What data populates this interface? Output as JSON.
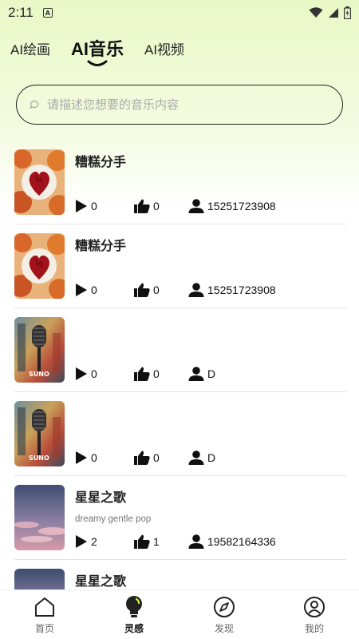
{
  "status_bar": {
    "time": "2:11",
    "notification_icon": "A"
  },
  "tabs": [
    {
      "label": "AI绘画"
    },
    {
      "label": "AI音乐",
      "active": true
    },
    {
      "label": "AI视频"
    }
  ],
  "search": {
    "placeholder": "请描述您想要的音乐内容",
    "value": ""
  },
  "songs": [
    {
      "title": "糟糕分手",
      "subtitle": "",
      "plays": "0",
      "likes": "0",
      "user": "15251723908",
      "cover": "heart-cover"
    },
    {
      "title": "糟糕分手",
      "subtitle": "",
      "plays": "0",
      "likes": "0",
      "user": "15251723908",
      "cover": "heart-cover"
    },
    {
      "title": "",
      "subtitle": "",
      "plays": "0",
      "likes": "0",
      "user": "D",
      "cover": "microphone-cover"
    },
    {
      "title": "",
      "subtitle": "",
      "plays": "0",
      "likes": "0",
      "user": "D",
      "cover": "microphone-cover"
    },
    {
      "title": "星星之歌",
      "subtitle": "dreamy gentle pop",
      "plays": "2",
      "likes": "1",
      "user": "19582164336",
      "cover": "sky-cover"
    },
    {
      "title": "星星之歌",
      "subtitle": "",
      "plays": "",
      "likes": "",
      "user": "",
      "cover": "sky-cover"
    }
  ],
  "bottom_nav": [
    {
      "label": "首页",
      "icon": "home-icon"
    },
    {
      "label": "灵感",
      "icon": "lightbulb-icon",
      "active": true
    },
    {
      "label": "发现",
      "icon": "compass-icon"
    },
    {
      "label": "我的",
      "icon": "user-circle-icon"
    }
  ]
}
